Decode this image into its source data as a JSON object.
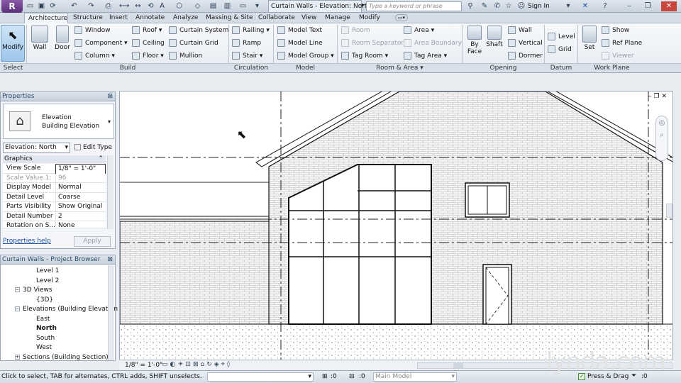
{
  "title_bar": {
    "document_title": "Curtain Walls - Elevation: North",
    "search_placeholder": "Type a keyword or phrase",
    "sign_in": "Sign In"
  },
  "ribbon_tabs": [
    "Architecture",
    "Structure",
    "Insert",
    "Annotate",
    "Analyze",
    "Massing & Site",
    "Collaborate",
    "View",
    "Manage",
    "Modify"
  ],
  "ribbon": {
    "modify": "Modify",
    "wall": "Wall",
    "door": "Door",
    "window": "Window",
    "component": "Component",
    "column": "Column",
    "roof": "Roof",
    "ceiling": "Ceiling",
    "floor": "Floor",
    "curtain_system": "Curtain System",
    "curtain_grid": "Curtain Grid",
    "mullion": "Mullion",
    "railing": "Railing",
    "ramp": "Ramp",
    "stair": "Stair",
    "model_text": "Model Text",
    "model_line": "Model Line",
    "model_group": "Model Group",
    "room": "Room",
    "room_separator": "Room Separator",
    "tag_room": "Tag Room",
    "area": "Area",
    "area_boundary": "Area Boundary",
    "tag_area": "Tag Area",
    "by_face_1": "By",
    "by_face_2": "Face",
    "shaft": "Shaft",
    "wall_opening": "Wall",
    "vertical": "Vertical",
    "dormer": "Dormer",
    "level": "Level",
    "grid": "Grid",
    "set": "Set",
    "show": "Show",
    "ref_plane": "Ref Plane",
    "viewer": "Viewer"
  },
  "panel_labels": {
    "select": "Select",
    "build": "Build",
    "circulation": "Circulation",
    "model": "Model",
    "room_area": "Room & Area",
    "opening": "Opening",
    "datum": "Datum",
    "work_plane": "Work Plane"
  },
  "properties": {
    "header": "Properties",
    "type_line1": "Elevation",
    "type_line2": "Building Elevation",
    "instance": "Elevation: North",
    "edit_type": "Edit Type",
    "group": "Graphics",
    "rows": [
      {
        "key": "View Scale",
        "value": "1/8\" = 1'-0\""
      },
      {
        "key": "Scale Value    1:",
        "value": "96"
      },
      {
        "key": "Display Model",
        "value": "Normal"
      },
      {
        "key": "Detail Level",
        "value": "Coarse"
      },
      {
        "key": "Parts Visibility",
        "value": "Show Original"
      },
      {
        "key": "Detail Number",
        "value": "2"
      },
      {
        "key": "Rotation on S...",
        "value": "None"
      }
    ],
    "help": "Properties help",
    "apply": "Apply"
  },
  "browser": {
    "header": "Curtain Walls - Project Browser",
    "items": [
      "Level 1",
      "Level 2",
      "3D Views",
      "{3D}",
      "Elevations (Building Elevation",
      "East",
      "North",
      "South",
      "West",
      "Sections (Building Section)"
    ]
  },
  "view_bar": {
    "scale": "1/8\" = 1'-0\""
  },
  "status": {
    "hint": "Click to select, TAB for alternates, CTRL adds, SHIFT unselects.",
    "coord1": ":0",
    "coord2": ":0",
    "model": "Main Model",
    "press_drag": "Press & Drag",
    "filter": ":0"
  },
  "watermark": "lynda.com"
}
